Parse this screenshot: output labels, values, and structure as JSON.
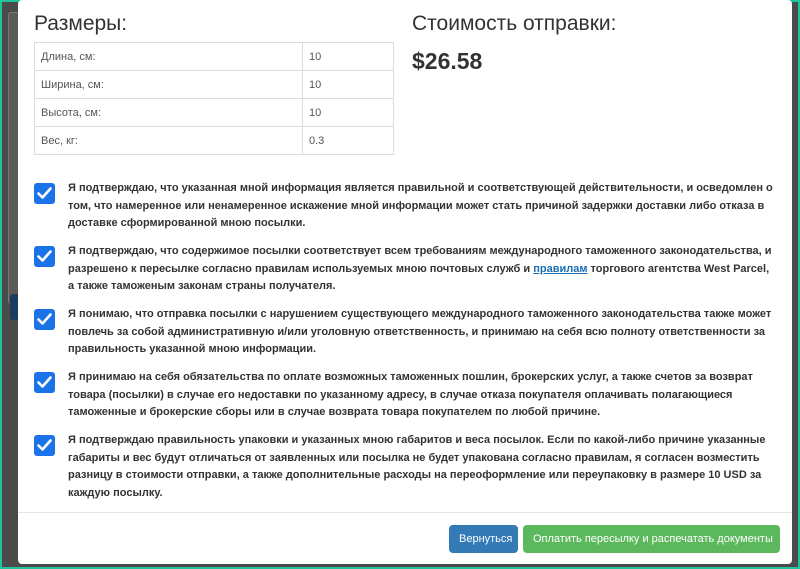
{
  "modal": {
    "dimensions_title": "Размеры:",
    "cost_title": "Стоимость отправки:",
    "cost_value": "$26.58",
    "dimensions": [
      {
        "label": "Длина, см:",
        "value": "10"
      },
      {
        "label": "Ширина, см:",
        "value": "10"
      },
      {
        "label": "Высота, см:",
        "value": "10"
      },
      {
        "label": "Вес, кг:",
        "value": "0.3"
      }
    ],
    "agreements": [
      {
        "checked": true,
        "text": "Я подтверждаю, что указанная мной информация является правильной и соответствующей действительности, и осведомлен о том, что намеренное или ненамеренное искажение мной информации может стать причиной задержки доставки либо отказа в доставке сформированной мною посылки."
      },
      {
        "checked": true,
        "text_before": "Я подтверждаю, что содержимое посылки соответствует всем требованиям международного таможенного законодательства, и разрешено к пересылке согласно правилам используемых мною почтовых служб и ",
        "link": "правилам",
        "text_after": " торгового агентства West Parcel, а также таможеным законам страны получателя."
      },
      {
        "checked": true,
        "text": "Я понимаю, что отправка посылки с нарушением существующего международного таможенного законодательства также может повлечь за собой административную и/или уголовную ответственность, и принимаю на себя всю полноту ответственности за правильность указанной мною информации."
      },
      {
        "checked": true,
        "text": "Я принимаю на себя обязательства по оплате возможных таможенных пошлин, брокерских услуг, а также счетов за возврат товара (посылки) в случае его недоставки по указанному адресу, в случае отказа покупателя оплачивать полагающиеся таможенные и брокерские сборы или в случае возврата товара покупателем по любой причине."
      },
      {
        "checked": true,
        "text": "Я подтверждаю правильность упаковки и указанных мною габаритов и веса посылок. Если по какой-либо причине указанные габариты и вес будут отличаться от заявленных или посылка не будет упакована согласно правилам, я согласен возместить разницу в стоимости отправки, а также дополнительные расходы на переоформление или переупаковку в размере 10 USD за каждую посылку."
      }
    ],
    "buttons": {
      "back": "Вернуться",
      "pay": "Оплатить пересылку и распечатать документы"
    }
  },
  "colors": {
    "frame": "#1fc49a",
    "checkbox": "#1a73e8",
    "back_button": "#337ab7",
    "pay_button": "#5cb85c",
    "link": "#1a6fb5"
  }
}
